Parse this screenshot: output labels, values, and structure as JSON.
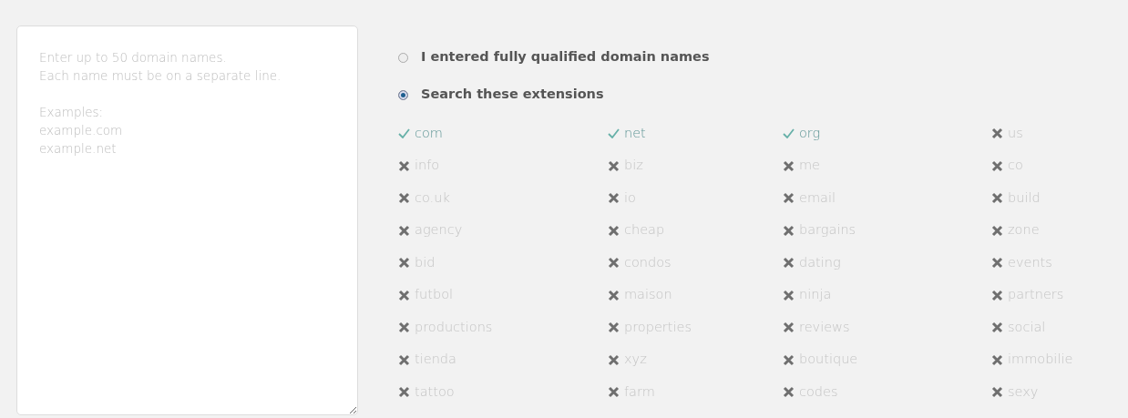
{
  "domains_field": {
    "placeholder": "Enter up to 50 domain names.\nEach name must be on a separate line.\n\nExamples:\nexample.com\nexample.net"
  },
  "mode_options": [
    {
      "label": "I entered fully qualified domain names",
      "selected": false
    },
    {
      "label": "Search these extensions",
      "selected": true
    }
  ],
  "extensions": [
    {
      "label": "com",
      "checked": true
    },
    {
      "label": "net",
      "checked": true
    },
    {
      "label": "org",
      "checked": true
    },
    {
      "label": "us",
      "checked": false
    },
    {
      "label": "info",
      "checked": false
    },
    {
      "label": "biz",
      "checked": false
    },
    {
      "label": "me",
      "checked": false
    },
    {
      "label": "co",
      "checked": false
    },
    {
      "label": "co.uk",
      "checked": false
    },
    {
      "label": "io",
      "checked": false
    },
    {
      "label": "email",
      "checked": false
    },
    {
      "label": "build",
      "checked": false
    },
    {
      "label": "agency",
      "checked": false
    },
    {
      "label": "cheap",
      "checked": false
    },
    {
      "label": "bargains",
      "checked": false
    },
    {
      "label": "zone",
      "checked": false
    },
    {
      "label": "bid",
      "checked": false
    },
    {
      "label": "condos",
      "checked": false
    },
    {
      "label": "dating",
      "checked": false
    },
    {
      "label": "events",
      "checked": false
    },
    {
      "label": "futbol",
      "checked": false
    },
    {
      "label": "maison",
      "checked": false
    },
    {
      "label": "ninja",
      "checked": false
    },
    {
      "label": "partners",
      "checked": false
    },
    {
      "label": "productions",
      "checked": false
    },
    {
      "label": "properties",
      "checked": false
    },
    {
      "label": "reviews",
      "checked": false
    },
    {
      "label": "social",
      "checked": false
    },
    {
      "label": "tienda",
      "checked": false
    },
    {
      "label": "xyz",
      "checked": false
    },
    {
      "label": "boutique",
      "checked": false
    },
    {
      "label": "immobilie",
      "checked": false
    },
    {
      "label": "tattoo",
      "checked": false
    },
    {
      "label": "farm",
      "checked": false
    },
    {
      "label": "codes",
      "checked": false
    },
    {
      "label": "sexy",
      "checked": false
    }
  ]
}
